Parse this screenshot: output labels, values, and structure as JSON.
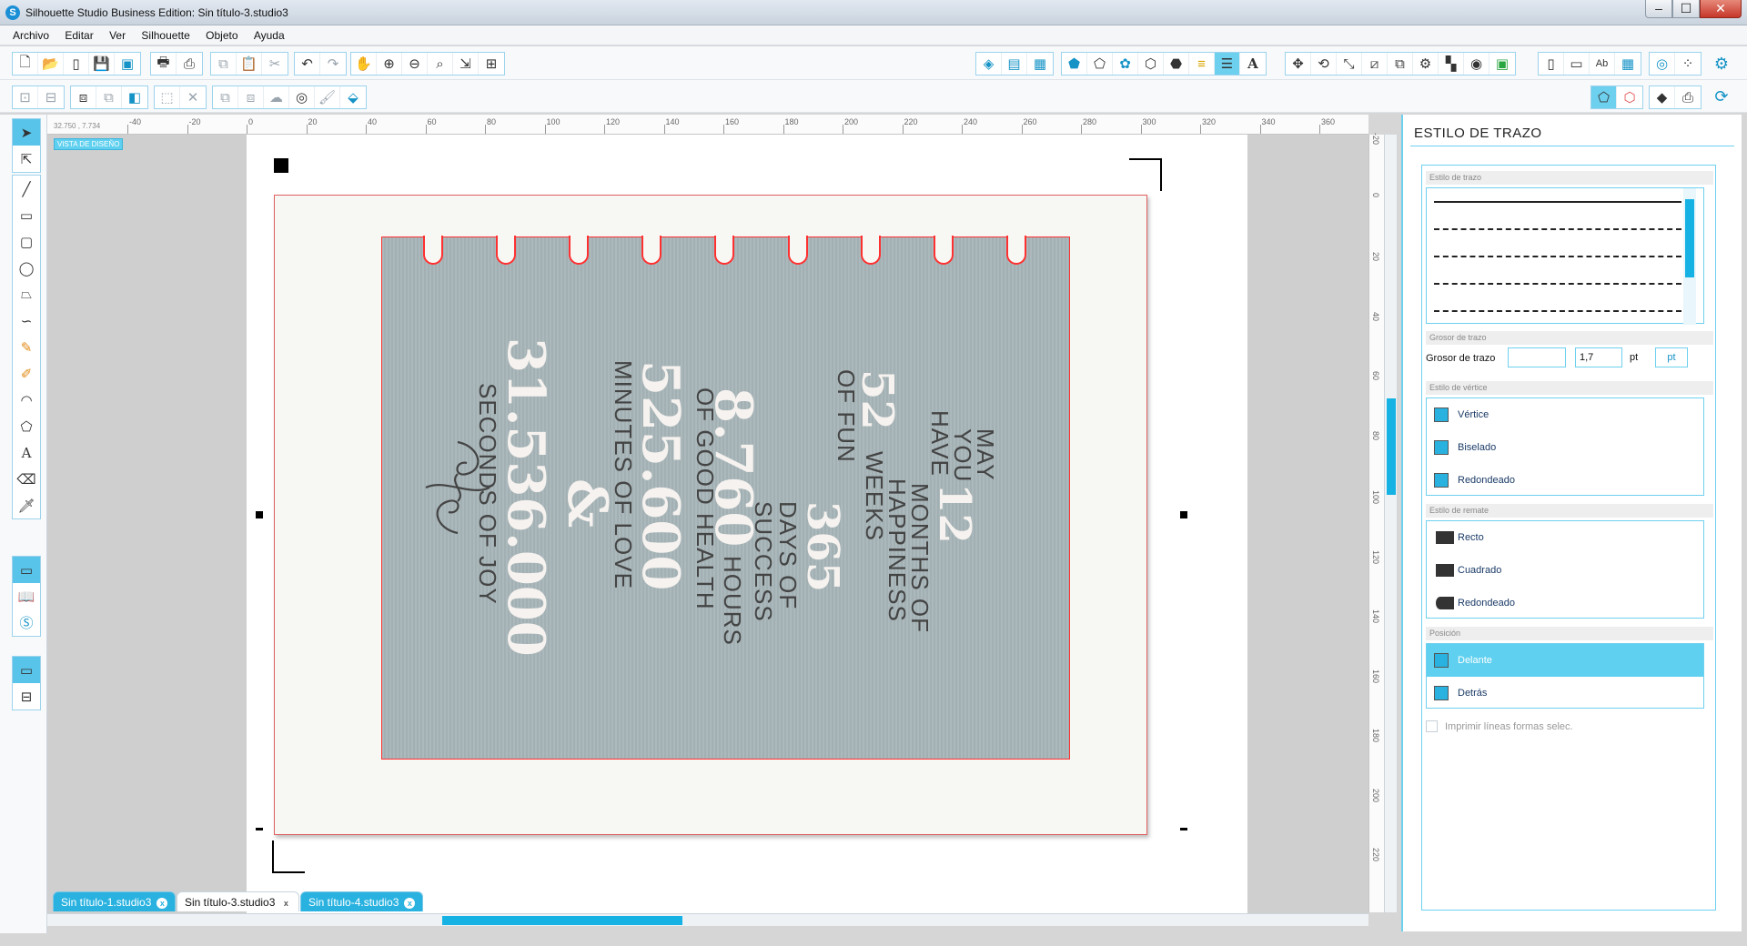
{
  "window": {
    "title": "Silhouette Studio Business Edition: Sin título-3.studio3",
    "min": "–",
    "max": "☐",
    "close": "✕"
  },
  "menu": [
    "Archivo",
    "Editar",
    "Ver",
    "Silhouette",
    "Objeto",
    "Ayuda"
  ],
  "canvas": {
    "coord_readout": "32.750 , 7.734",
    "view_badge": "VISTA DE DISEÑO",
    "ruler_labels": [
      "-40",
      "-20",
      "0",
      "20",
      "40",
      "60",
      "80",
      "100",
      "120",
      "140",
      "160",
      "180",
      "200",
      "220",
      "240",
      "260",
      "280",
      "300",
      "320",
      "340",
      "360"
    ],
    "vruler_labels": [
      "-20",
      "0",
      "20",
      "40",
      "60",
      "80",
      "100",
      "120",
      "140",
      "160",
      "180",
      "200",
      "220"
    ]
  },
  "artwork": {
    "lines": [
      {
        "text": "MAY",
        "style": "thin"
      },
      {
        "text": "YOU",
        "style": "thin"
      },
      {
        "text": "HAVE",
        "style": "thin"
      },
      {
        "text": "12",
        "style": "big"
      },
      {
        "text": "MONTHS OF",
        "style": "thin"
      },
      {
        "text": "HAPPINESS",
        "style": "thin"
      },
      {
        "text": "52",
        "style": "big"
      },
      {
        "text": "WEEKS",
        "style": "thin"
      },
      {
        "text": "OF FUN",
        "style": "thin"
      },
      {
        "text": "365",
        "style": "big"
      },
      {
        "text": "DAYS OF",
        "style": "thin"
      },
      {
        "text": "SUCCESS",
        "style": "thin"
      },
      {
        "text": "8.760",
        "style": "big"
      },
      {
        "text": "HOURS",
        "style": "thin"
      },
      {
        "text": "OF GOOD HEALTH",
        "style": "thin"
      },
      {
        "text": "525.600",
        "style": "big"
      },
      {
        "text": "MINUTES OF LOVE",
        "style": "thin"
      },
      {
        "text": "&",
        "style": "big"
      },
      {
        "text": "31.536.000",
        "style": "big"
      },
      {
        "text": "SECONDS OF JOY",
        "style": "thin"
      }
    ]
  },
  "tabs": [
    {
      "label": "Sin título-1.studio3",
      "active": false,
      "close": "x"
    },
    {
      "label": "Sin título-3.studio3",
      "active": true,
      "close": "x"
    },
    {
      "label": "Sin título-4.studio3",
      "active": false,
      "close": "x"
    }
  ],
  "panel": {
    "title": "ESTILO DE TRAZO",
    "sections": {
      "estilo_trazo": "Estilo de trazo",
      "grosor": "Grosor de trazo",
      "vertice": "Estilo de vértice",
      "remate": "Estilo de remate",
      "posicion": "Posición"
    },
    "grosor_label": "Grosor de trazo",
    "grosor_value": "1,7",
    "grosor_unit": "pt",
    "unit_button": "pt",
    "vertice_options": [
      "Vértice",
      "Biselado",
      "Redondeado"
    ],
    "remate_options": [
      "Recto",
      "Cuadrado",
      "Redondeado"
    ],
    "posicion_options": [
      {
        "label": "Delante",
        "selected": true
      },
      {
        "label": "Detrás",
        "selected": false
      }
    ],
    "print_checkbox": "Imprimir líneas formas selec."
  },
  "colors": {
    "accent": "#29b2e0",
    "cut_line": "#ff3030",
    "card": "#a8b6b9"
  }
}
